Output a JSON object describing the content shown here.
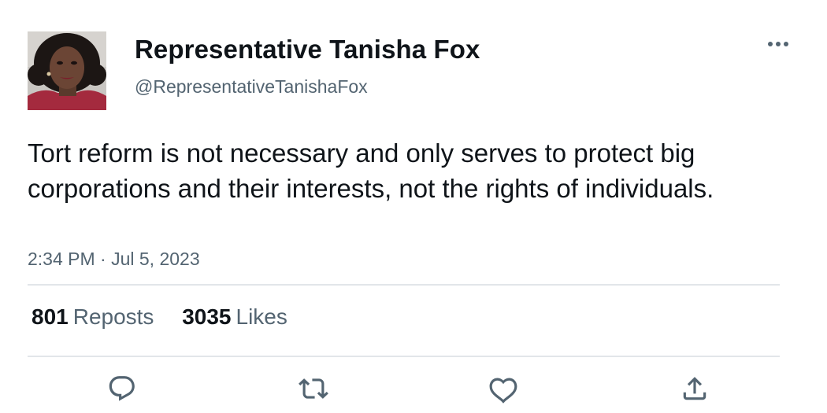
{
  "tweet": {
    "author": {
      "display_name": "Representative Tanisha Fox",
      "handle": "@RepresentativeTanishaFox"
    },
    "text": "Tort reform is not necessary and only serves to protect big corporations and their interests, not the rights of individuals.",
    "timestamp": "2:34 PM · Jul 5, 2023",
    "stats": {
      "reposts": {
        "count": "801",
        "label": "Reposts"
      },
      "likes": {
        "count": "3035",
        "label": "Likes"
      }
    },
    "actions": {
      "reply_icon": "reply-icon",
      "repost_icon": "repost-icon",
      "like_icon": "heart-icon",
      "share_icon": "share-icon"
    },
    "more_icon": "more-icon"
  },
  "colors": {
    "text": "#0f1419",
    "secondary": "#536471",
    "divider": "#e2e6e9"
  }
}
